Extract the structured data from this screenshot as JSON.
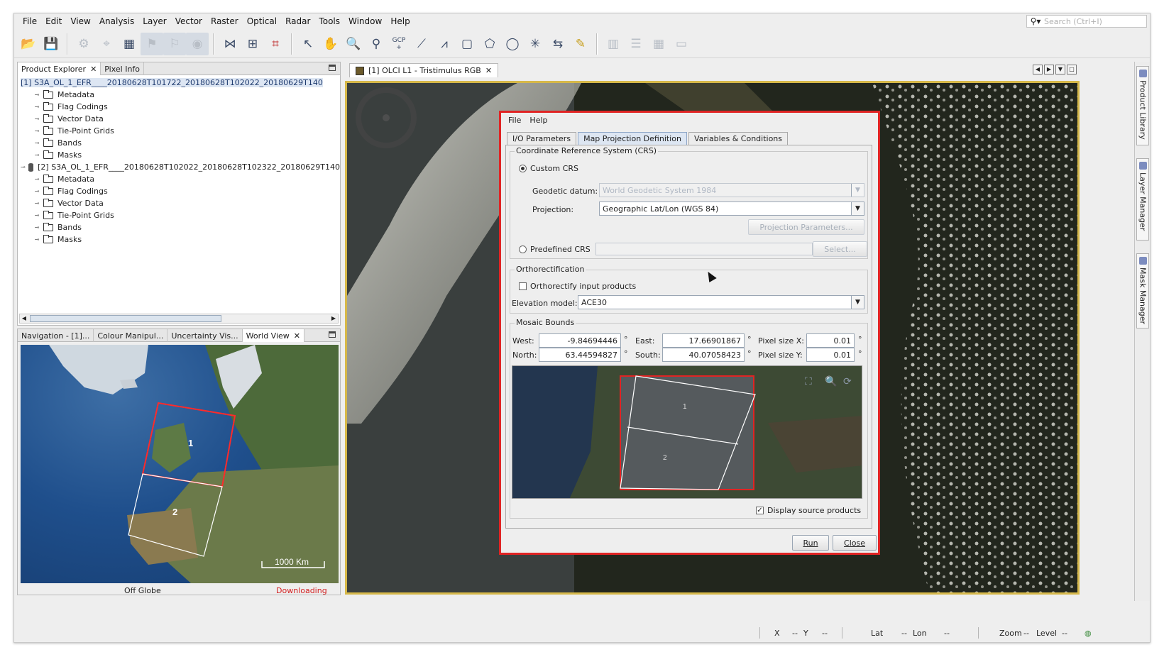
{
  "menubar": {
    "items": [
      "File",
      "Edit",
      "View",
      "Analysis",
      "Layer",
      "Vector",
      "Raster",
      "Optical",
      "Radar",
      "Tools",
      "Window",
      "Help"
    ],
    "search_placeholder": "Search (Ctrl+I)"
  },
  "toolbar": {
    "icons": [
      "open-product-icon",
      "save-product-icon",
      "wand-icon",
      "pin-icon",
      "grid-icon",
      "cursor-sync-icon",
      "view-sync-icon",
      "globe-icon",
      "graph-builder-icon",
      "batch-processing-icon",
      "map-icon",
      "select-tool-icon",
      "pan-tool-icon",
      "zoom-tool-icon",
      "pin-placing-icon",
      "gcp-placing-icon",
      "line-drawing-icon",
      "polyline-drawing-icon",
      "rectangle-drawing-icon",
      "polygon-drawing-icon",
      "ellipse-drawing-icon",
      "magic-wand-icon",
      "range-finder-icon",
      "ruler-icon",
      "tile-evenly-icon",
      "tile-horizontal-icon",
      "tile-vertical-icon",
      "tile-single-icon"
    ],
    "gcp_label": "GCP"
  },
  "product_explorer": {
    "tabs": [
      "Product Explorer",
      "Pixel Info"
    ],
    "products": [
      {
        "label": "[1] S3A_OL_1_EFR____20180628T101722_20180628T102022_20180629T140",
        "children": [
          "Metadata",
          "Flag Codings",
          "Vector Data",
          "Tie-Point Grids",
          "Bands",
          "Masks"
        ]
      },
      {
        "label": "[2] S3A_OL_1_EFR____20180628T102022_20180628T102322_20180629T140",
        "children": [
          "Metadata",
          "Flag Codings",
          "Vector Data",
          "Tie-Point Grids",
          "Bands",
          "Masks"
        ]
      }
    ]
  },
  "world_view": {
    "tabs": [
      "Navigation - [1]...",
      "Colour Manipul...",
      "Uncertainty Vis...",
      "World View"
    ],
    "footprint_labels": [
      "1",
      "2"
    ],
    "scale_label": "1000 Km",
    "status_left": "Off Globe",
    "status_right": "Downloading"
  },
  "image_view": {
    "tab_label": "[1] OLCI L1 - Tristimulus RGB"
  },
  "side_tabs": [
    "Product Library",
    "Layer Manager",
    "Mask Manager"
  ],
  "status_bar": {
    "x_label": "X",
    "x_value": "--",
    "y_label": "Y",
    "y_value": "--",
    "lat_label": "Lat",
    "lat_value": "--",
    "lon_label": "Lon",
    "lon_value": "--",
    "zoom_label": "Zoom",
    "zoom_value": "--",
    "level_label": "Level",
    "level_value": "--"
  },
  "dialog": {
    "menu": [
      "File",
      "Help"
    ],
    "tabs": [
      "I/O Parameters",
      "Map Projection Definition",
      "Variables & Conditions"
    ],
    "crs_group": "Coordinate Reference System (CRS)",
    "custom_crs": "Custom CRS",
    "geodetic_label": "Geodetic datum:",
    "geodetic_value": "World Geodetic System 1984",
    "projection_label": "Projection:",
    "projection_value": "Geographic Lat/Lon (WGS 84)",
    "projection_params": "Projection Parameters...",
    "predefined_crs": "Predefined CRS",
    "select_btn": "Select...",
    "ortho_group": "Orthorectification",
    "ortho_check": "Orthorectify input products",
    "elevation_label": "Elevation model:",
    "elevation_value": "ACE30",
    "bounds_group": "Mosaic Bounds",
    "west_label": "West:",
    "west_value": "-9.84694446",
    "east_label": "East:",
    "east_value": "17.66901867",
    "north_label": "North:",
    "north_value": "63.44594827",
    "south_label": "South:",
    "south_value": "40.07058423",
    "pixel_x_label": "Pixel size X:",
    "pixel_x_value": "0.01",
    "pixel_y_label": "Pixel size Y:",
    "pixel_y_value": "0.01",
    "degree_unit": "°",
    "preview_labels": [
      "1",
      "2"
    ],
    "display_source": "Display source products",
    "run_btn": "Run",
    "close_btn": "Close"
  }
}
